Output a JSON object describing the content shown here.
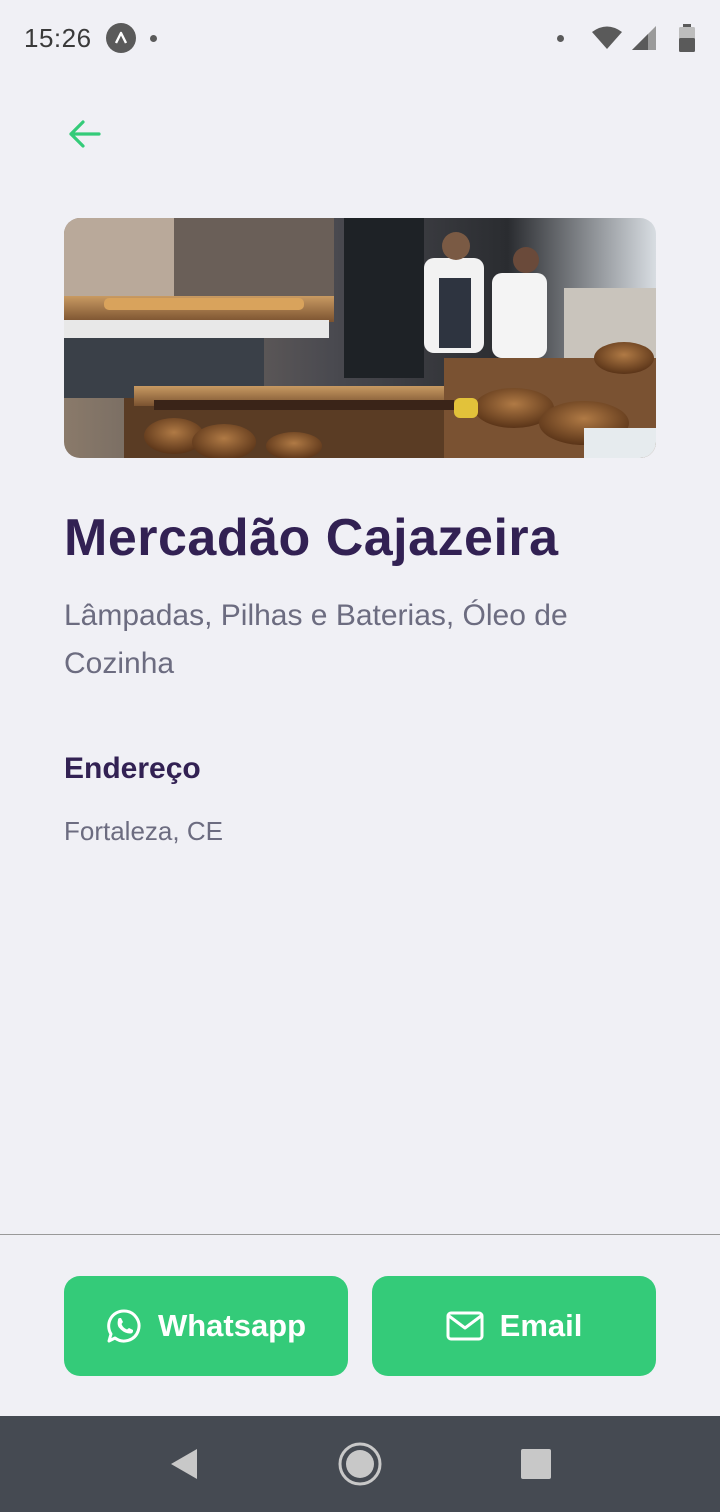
{
  "status_bar": {
    "time": "15:26",
    "icons": [
      "app-notification-icon",
      "dot-icon",
      "wifi-icon",
      "signal-icon",
      "battery-icon"
    ]
  },
  "header": {
    "back_icon": "arrow-left-icon"
  },
  "colors": {
    "accent": "#34cb79",
    "title": "#322153",
    "text": "#6c6c80",
    "background": "#f0f0f5",
    "nav_bar": "#454a52"
  },
  "point": {
    "image": "bakery-market-photo",
    "name": "Mercadão Cajazeira",
    "items": "Lâmpadas, Pilhas e Baterias, Óleo de Cozinha"
  },
  "address": {
    "title": "Endereço",
    "value": "Fortaleza, CE"
  },
  "footer": {
    "whatsapp_label": "Whatsapp",
    "whatsapp_icon": "whatsapp-icon",
    "email_label": "Email",
    "email_icon": "mail-icon"
  },
  "nav": {
    "icons": [
      "back-triangle-icon",
      "home-circle-icon",
      "recents-square-icon"
    ]
  }
}
